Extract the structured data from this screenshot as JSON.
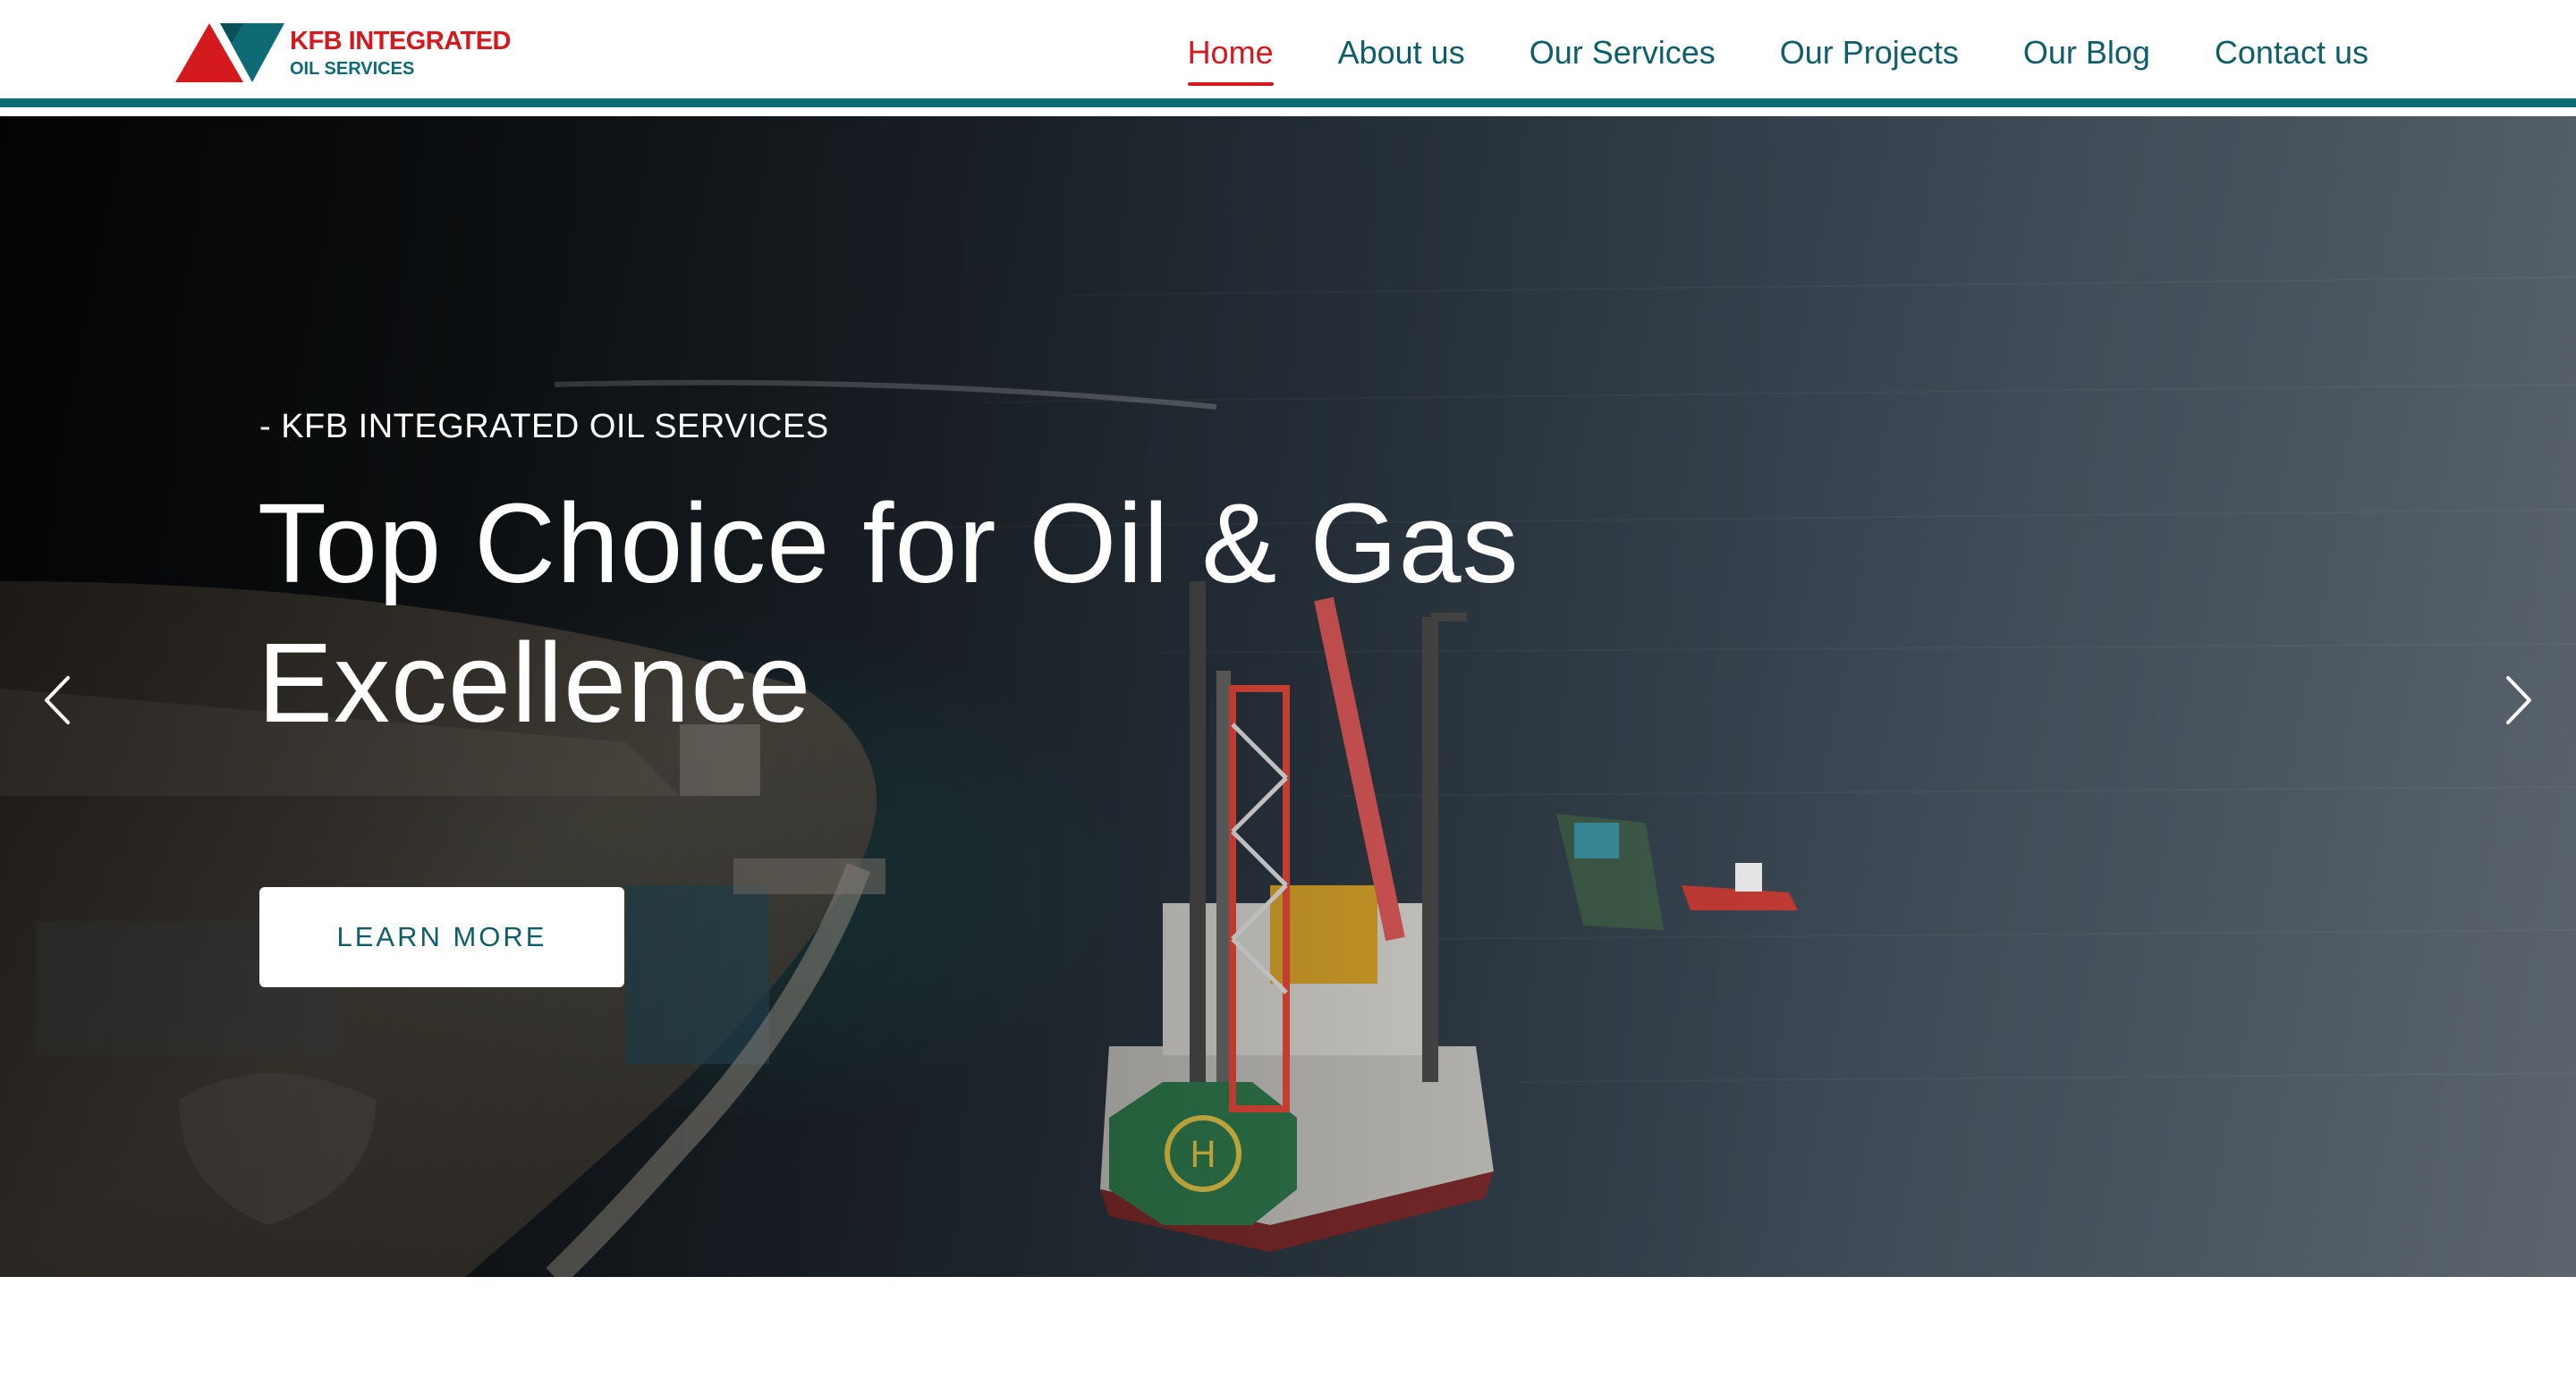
{
  "header": {
    "logo": {
      "line1": "KFB INTEGRATED",
      "line2": "OIL SERVICES",
      "colors": {
        "red": "#d41a1f",
        "teal": "#0e6b76"
      }
    },
    "nav": [
      {
        "label": "Home",
        "active": true
      },
      {
        "label": "About us",
        "active": false
      },
      {
        "label": "Our Services",
        "active": false
      },
      {
        "label": "Our Projects",
        "active": false
      },
      {
        "label": "Our Blog",
        "active": false
      },
      {
        "label": "Contact us",
        "active": false
      }
    ],
    "accent_bar_color": "#0e6b76"
  },
  "hero": {
    "kicker": "- KFB INTEGRATED OIL SERVICES",
    "title_line1": "Top Choice for Oil & Gas",
    "title_line2": "Excellence",
    "button_label": "LEARN MORE",
    "prev_icon": "chevron-left-icon",
    "next_icon": "chevron-right-icon",
    "background_image": "aerial-oil-rig-ocean-photo"
  },
  "colors": {
    "active_nav": "#d41a1f",
    "nav_text": "#0e5e6a",
    "button_text": "#0e5e6a"
  }
}
